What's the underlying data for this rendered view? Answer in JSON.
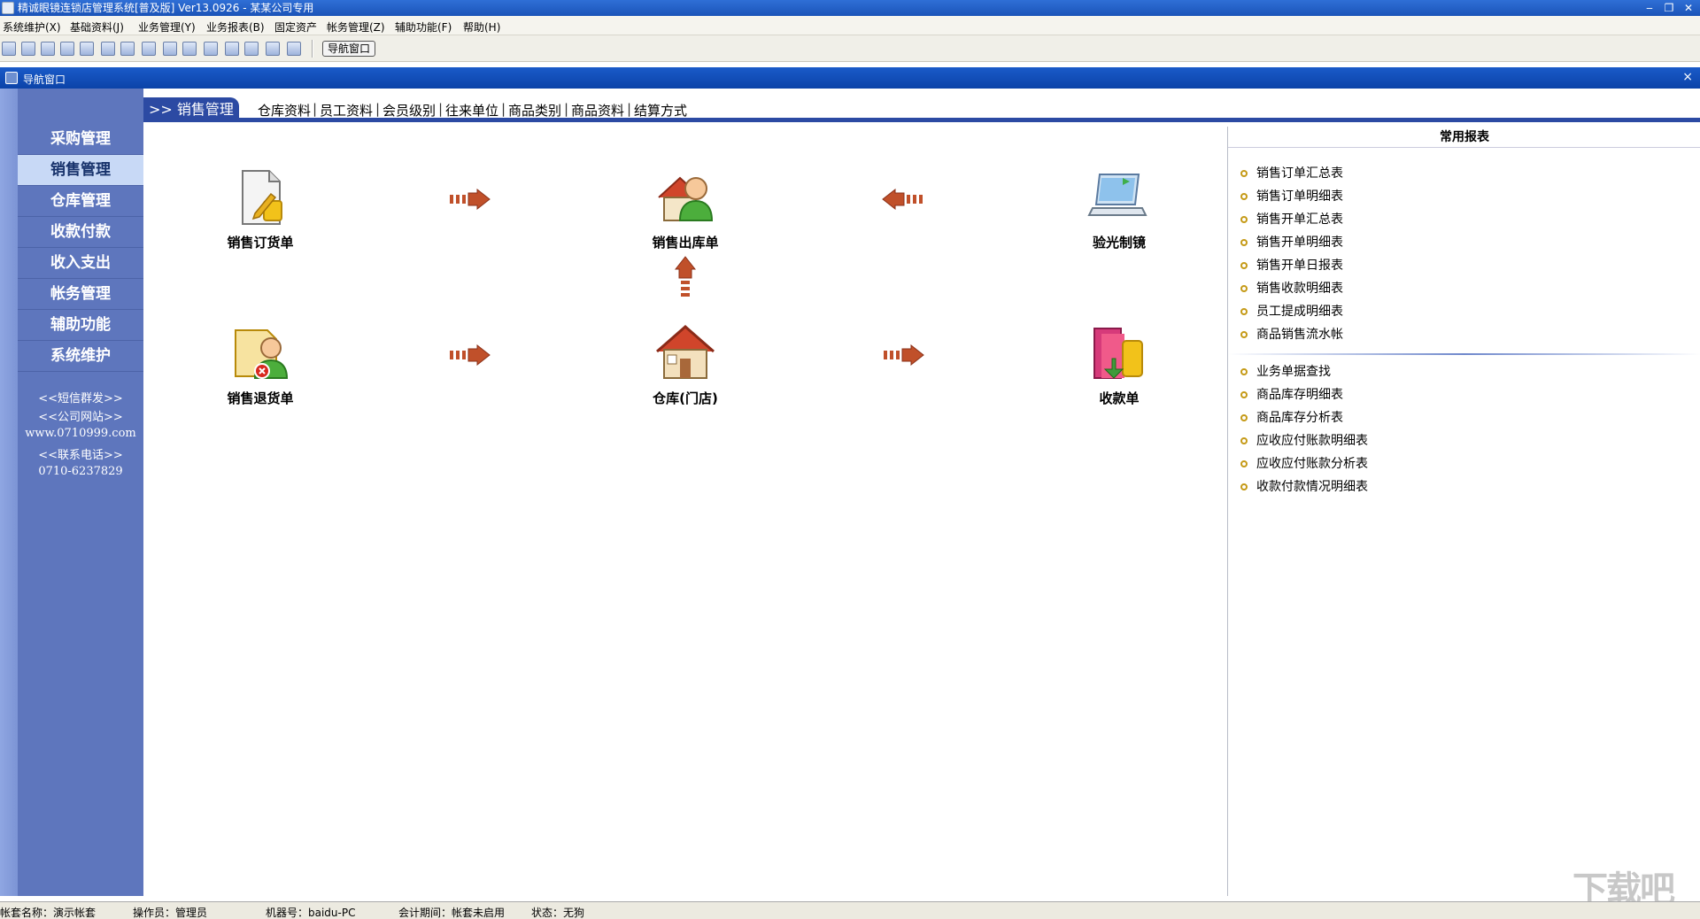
{
  "window": {
    "title": "精诚眼镜连锁店管理系统[普及版] Ver13.0926  -  某某公司专用",
    "min": "‒",
    "restore": "❐",
    "close": "✕"
  },
  "menu": [
    "系统维护(X)",
    "基础资料(J)",
    "业务管理(Y)",
    "业务报表(B)",
    "固定资产",
    "帐务管理(Z)",
    "辅助功能(F)",
    "帮助(H)"
  ],
  "toolbar": {
    "nav_button": "导航窗口"
  },
  "child_window": {
    "title": "导航窗口",
    "close": "×"
  },
  "left_nav": {
    "items": [
      "采购管理",
      "销售管理",
      "仓库管理",
      "收款付款",
      "收入支出",
      "帐务管理",
      "辅助功能",
      "系统维护"
    ],
    "active": "销售管理",
    "links": [
      "<<短信群发>>",
      "<<公司网站>>",
      "www.0710999.com",
      "<<联系电话>>",
      "0710-6237829"
    ]
  },
  "linkbar": {
    "title": ">> 销售管理",
    "links": [
      "仓库资料",
      "员工资料",
      "会员级别",
      "往来单位",
      "商品类别",
      "商品资料",
      "结算方式"
    ]
  },
  "flow": {
    "nodes": {
      "sales_order": "销售订货单",
      "sales_out": "销售出库单",
      "optometry": "验光制镜",
      "sales_return": "销售退货单",
      "warehouse": "仓库(门店)",
      "receipt": "收款单"
    }
  },
  "reports": {
    "title": "常用报表",
    "group1": [
      "销售订单汇总表",
      "销售订单明细表",
      "销售开单汇总表",
      "销售开单明细表",
      "销售开单日报表",
      "销售收款明细表",
      "员工提成明细表",
      "商品销售流水帐"
    ],
    "group2": [
      "业务单据查找",
      "商品库存明细表",
      "商品库存分析表",
      "应收应付账款明细表",
      "应收应付账款分析表",
      "收款付款情况明细表"
    ]
  },
  "status": {
    "account": "帐套名称：演示帐套",
    "operator": "操作员：管理员",
    "machine": "机器号：baidu-PC",
    "period": "会计期间：帐套未启用",
    "state": "状态：无狗"
  },
  "watermark": "下载吧"
}
